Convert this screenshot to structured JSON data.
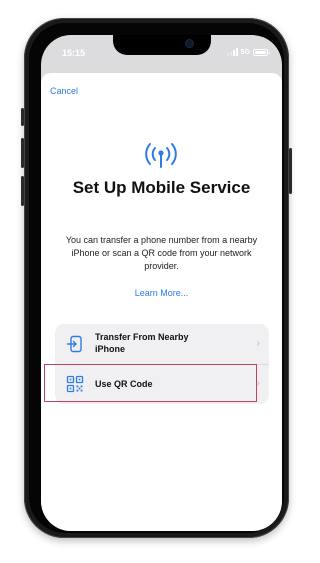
{
  "status_bar": {
    "time": "15:15",
    "network": "5G",
    "signal_bars": 2,
    "battery_level": 1.0
  },
  "sheet": {
    "cancel_label": "Cancel",
    "header_icon": "antenna-icon",
    "title": "Set Up Mobile Service",
    "description": "You can transfer a phone number from a nearby iPhone or scan a QR code from your network provider.",
    "learn_more_label": "Learn More..."
  },
  "options": [
    {
      "icon": "transfer-phone-icon",
      "label": "Transfer From Nearby iPhone"
    },
    {
      "icon": "qr-code-icon",
      "label": "Use QR Code"
    }
  ],
  "colors": {
    "link_blue": "#2d7ce5",
    "highlight_border": "#b9465e",
    "option_background": "#f0f0f3"
  }
}
